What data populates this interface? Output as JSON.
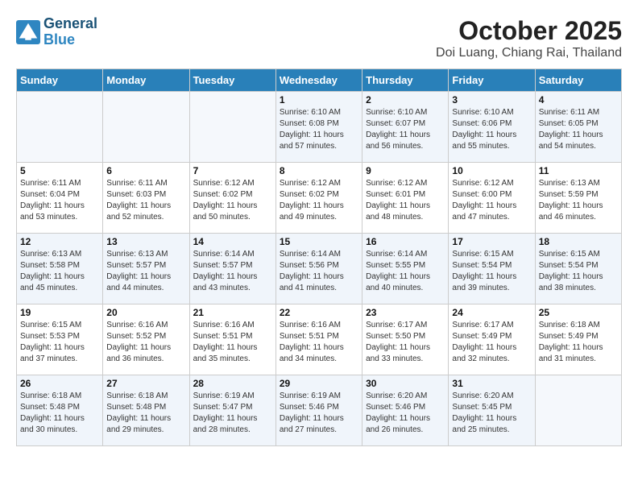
{
  "header": {
    "logo_line1": "General",
    "logo_line2": "Blue",
    "month": "October 2025",
    "location": "Doi Luang, Chiang Rai, Thailand"
  },
  "days_of_week": [
    "Sunday",
    "Monday",
    "Tuesday",
    "Wednesday",
    "Thursday",
    "Friday",
    "Saturday"
  ],
  "weeks": [
    [
      {
        "day": "",
        "info": ""
      },
      {
        "day": "",
        "info": ""
      },
      {
        "day": "",
        "info": ""
      },
      {
        "day": "1",
        "info": "Sunrise: 6:10 AM\nSunset: 6:08 PM\nDaylight: 11 hours\nand 57 minutes."
      },
      {
        "day": "2",
        "info": "Sunrise: 6:10 AM\nSunset: 6:07 PM\nDaylight: 11 hours\nand 56 minutes."
      },
      {
        "day": "3",
        "info": "Sunrise: 6:10 AM\nSunset: 6:06 PM\nDaylight: 11 hours\nand 55 minutes."
      },
      {
        "day": "4",
        "info": "Sunrise: 6:11 AM\nSunset: 6:05 PM\nDaylight: 11 hours\nand 54 minutes."
      }
    ],
    [
      {
        "day": "5",
        "info": "Sunrise: 6:11 AM\nSunset: 6:04 PM\nDaylight: 11 hours\nand 53 minutes."
      },
      {
        "day": "6",
        "info": "Sunrise: 6:11 AM\nSunset: 6:03 PM\nDaylight: 11 hours\nand 52 minutes."
      },
      {
        "day": "7",
        "info": "Sunrise: 6:12 AM\nSunset: 6:02 PM\nDaylight: 11 hours\nand 50 minutes."
      },
      {
        "day": "8",
        "info": "Sunrise: 6:12 AM\nSunset: 6:02 PM\nDaylight: 11 hours\nand 49 minutes."
      },
      {
        "day": "9",
        "info": "Sunrise: 6:12 AM\nSunset: 6:01 PM\nDaylight: 11 hours\nand 48 minutes."
      },
      {
        "day": "10",
        "info": "Sunrise: 6:12 AM\nSunset: 6:00 PM\nDaylight: 11 hours\nand 47 minutes."
      },
      {
        "day": "11",
        "info": "Sunrise: 6:13 AM\nSunset: 5:59 PM\nDaylight: 11 hours\nand 46 minutes."
      }
    ],
    [
      {
        "day": "12",
        "info": "Sunrise: 6:13 AM\nSunset: 5:58 PM\nDaylight: 11 hours\nand 45 minutes."
      },
      {
        "day": "13",
        "info": "Sunrise: 6:13 AM\nSunset: 5:57 PM\nDaylight: 11 hours\nand 44 minutes."
      },
      {
        "day": "14",
        "info": "Sunrise: 6:14 AM\nSunset: 5:57 PM\nDaylight: 11 hours\nand 43 minutes."
      },
      {
        "day": "15",
        "info": "Sunrise: 6:14 AM\nSunset: 5:56 PM\nDaylight: 11 hours\nand 41 minutes."
      },
      {
        "day": "16",
        "info": "Sunrise: 6:14 AM\nSunset: 5:55 PM\nDaylight: 11 hours\nand 40 minutes."
      },
      {
        "day": "17",
        "info": "Sunrise: 6:15 AM\nSunset: 5:54 PM\nDaylight: 11 hours\nand 39 minutes."
      },
      {
        "day": "18",
        "info": "Sunrise: 6:15 AM\nSunset: 5:54 PM\nDaylight: 11 hours\nand 38 minutes."
      }
    ],
    [
      {
        "day": "19",
        "info": "Sunrise: 6:15 AM\nSunset: 5:53 PM\nDaylight: 11 hours\nand 37 minutes."
      },
      {
        "day": "20",
        "info": "Sunrise: 6:16 AM\nSunset: 5:52 PM\nDaylight: 11 hours\nand 36 minutes."
      },
      {
        "day": "21",
        "info": "Sunrise: 6:16 AM\nSunset: 5:51 PM\nDaylight: 11 hours\nand 35 minutes."
      },
      {
        "day": "22",
        "info": "Sunrise: 6:16 AM\nSunset: 5:51 PM\nDaylight: 11 hours\nand 34 minutes."
      },
      {
        "day": "23",
        "info": "Sunrise: 6:17 AM\nSunset: 5:50 PM\nDaylight: 11 hours\nand 33 minutes."
      },
      {
        "day": "24",
        "info": "Sunrise: 6:17 AM\nSunset: 5:49 PM\nDaylight: 11 hours\nand 32 minutes."
      },
      {
        "day": "25",
        "info": "Sunrise: 6:18 AM\nSunset: 5:49 PM\nDaylight: 11 hours\nand 31 minutes."
      }
    ],
    [
      {
        "day": "26",
        "info": "Sunrise: 6:18 AM\nSunset: 5:48 PM\nDaylight: 11 hours\nand 30 minutes."
      },
      {
        "day": "27",
        "info": "Sunrise: 6:18 AM\nSunset: 5:48 PM\nDaylight: 11 hours\nand 29 minutes."
      },
      {
        "day": "28",
        "info": "Sunrise: 6:19 AM\nSunset: 5:47 PM\nDaylight: 11 hours\nand 28 minutes."
      },
      {
        "day": "29",
        "info": "Sunrise: 6:19 AM\nSunset: 5:46 PM\nDaylight: 11 hours\nand 27 minutes."
      },
      {
        "day": "30",
        "info": "Sunrise: 6:20 AM\nSunset: 5:46 PM\nDaylight: 11 hours\nand 26 minutes."
      },
      {
        "day": "31",
        "info": "Sunrise: 6:20 AM\nSunset: 5:45 PM\nDaylight: 11 hours\nand 25 minutes."
      },
      {
        "day": "",
        "info": ""
      }
    ]
  ]
}
